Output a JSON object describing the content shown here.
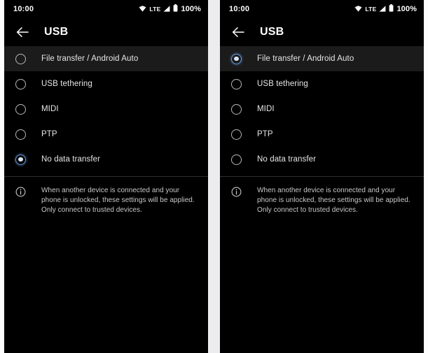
{
  "status_bar": {
    "time": "10:00",
    "network_label": "LTE",
    "battery_percent": "100%",
    "icons": {
      "wifi": "wifi-icon",
      "signal": "signal-icon",
      "battery": "battery-icon"
    }
  },
  "app_bar": {
    "title": "USB",
    "back_icon": "back-arrow-icon"
  },
  "options": [
    {
      "label": "File transfer / Android Auto"
    },
    {
      "label": "USB tethering"
    },
    {
      "label": "MIDI"
    },
    {
      "label": "PTP"
    },
    {
      "label": "No data transfer"
    }
  ],
  "footer": {
    "info_icon": "info-icon",
    "text": "When another device is connected and your phone is unlocked, these settings will be applied. Only connect to trusted devices."
  },
  "panels": [
    {
      "name": "left-panel",
      "selected_index": 4,
      "highlighted_index": 0
    },
    {
      "name": "right-panel",
      "selected_index": 0,
      "highlighted_index": 0
    }
  ],
  "colors": {
    "background": "#000000",
    "accent": "#6e9ede",
    "text_primary": "#e6e6e6",
    "text_secondary": "#c9c9c9",
    "row_highlight": "#1b1b1b",
    "divider": "#2e2e2e",
    "gutter": "#ececef"
  }
}
